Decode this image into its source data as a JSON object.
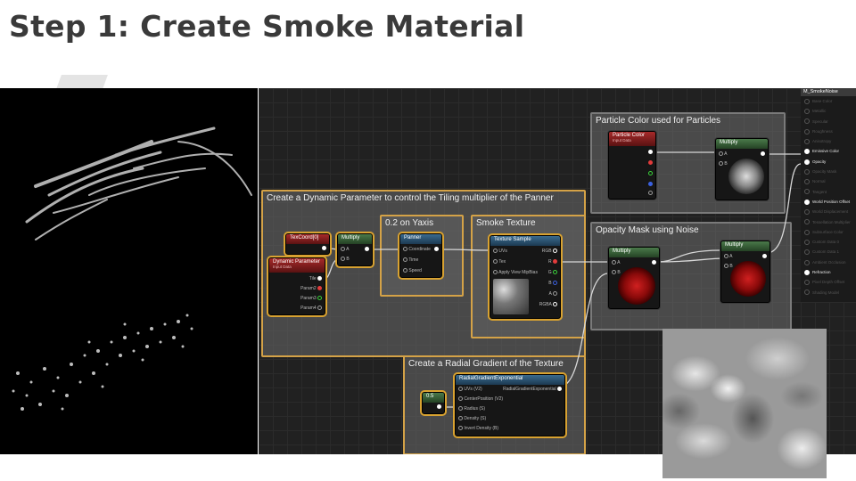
{
  "page": {
    "title": "Step 1: Create Smoke Material"
  },
  "comments": {
    "dynamic": "Create a Dynamic Parameter to control the Tiling multiplier of the Panner",
    "yaxis": "0.2 on Yaxis",
    "smoke_texture": "Smoke Texture",
    "particle_color": "Particle Color used for Particles",
    "opacity_mask": "Opacity Mask using Noise",
    "radial": "Create a Radial Gradient of the Texture"
  },
  "nodes": {
    "texcoord": {
      "title": "TexCoord[0]"
    },
    "dynparam": {
      "title": "Dynamic Parameter",
      "subtitle": "Input Data",
      "pins": [
        "Tile",
        "Param2",
        "Param3",
        "Param4"
      ]
    },
    "multiply1": {
      "title": "Multiply",
      "pins": [
        "A",
        "B"
      ]
    },
    "panner": {
      "title": "Panner",
      "pins": [
        "Coordinate",
        "Time",
        "Speed"
      ]
    },
    "texsample": {
      "title": "Texture Sample",
      "inputs": [
        "UVs",
        "Tex",
        "Apply View MipBias"
      ],
      "outputs": [
        "RGB",
        "R",
        "G",
        "B",
        "A",
        "RGBA"
      ]
    },
    "particlecolor": {
      "title": "Particle Color",
      "subtitle": "Input Data"
    },
    "multiply_top": {
      "title": "Multiply",
      "pins": [
        "A",
        "B"
      ]
    },
    "multiply_mid": {
      "title": "Multiply",
      "pins": [
        "A",
        "B"
      ]
    },
    "multiply_right": {
      "title": "Multiply",
      "pins": [
        "A",
        "B"
      ]
    },
    "const": {
      "title": "0.5"
    },
    "radial": {
      "title": "RadialGradientExponential",
      "inputs": [
        "UVs (V2)",
        "CenterPosition (V2)",
        "Radius (S)",
        "Density (S)",
        "Invert Density (B)"
      ],
      "output": "RadialGradientExponential"
    }
  },
  "outputs": {
    "title": "M_SmokeNoise",
    "items": [
      {
        "label": "Base Color",
        "active": false
      },
      {
        "label": "Metallic",
        "active": false
      },
      {
        "label": "Specular",
        "active": false
      },
      {
        "label": "Roughness",
        "active": false
      },
      {
        "label": "Anisotropy",
        "active": false
      },
      {
        "label": "Emissive Color",
        "active": true
      },
      {
        "label": "Opacity",
        "active": true
      },
      {
        "label": "Opacity Mask",
        "active": false
      },
      {
        "label": "Normal",
        "active": false
      },
      {
        "label": "Tangent",
        "active": false
      },
      {
        "label": "World Position Offset",
        "active": true
      },
      {
        "label": "World Displacement",
        "active": false
      },
      {
        "label": "Tessellation Multiplier",
        "active": false
      },
      {
        "label": "Subsurface Color",
        "active": false
      },
      {
        "label": "Custom Data 0",
        "active": false
      },
      {
        "label": "Custom Data 1",
        "active": false
      },
      {
        "label": "Ambient Occlusion",
        "active": false
      },
      {
        "label": "Refraction",
        "active": true
      },
      {
        "label": "Pixel Depth Offset",
        "active": false
      },
      {
        "label": "Shading Model",
        "active": false
      }
    ]
  }
}
